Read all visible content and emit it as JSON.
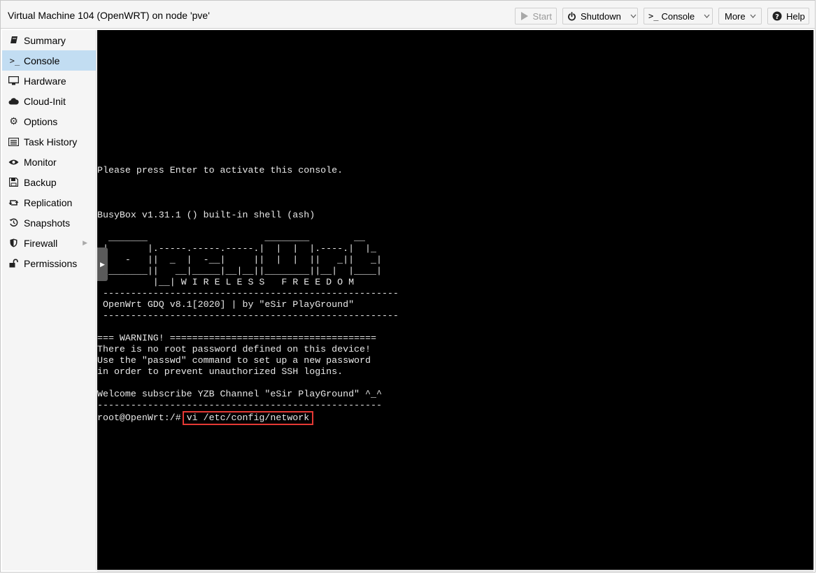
{
  "window": {
    "title": "Virtual Machine 104 (OpenWRT) on node 'pve'"
  },
  "toolbar": {
    "start": {
      "label": "Start",
      "icon": "play-icon"
    },
    "shutdown": {
      "label": "Shutdown",
      "icon": "power-icon"
    },
    "console": {
      "label": "Console",
      "icon": "terminal-icon"
    },
    "more": {
      "label": "More"
    },
    "help": {
      "label": "Help",
      "icon": "question-circle-icon"
    }
  },
  "sidebar": {
    "items": [
      {
        "label": "Summary",
        "icon": "book-icon"
      },
      {
        "label": "Console",
        "icon": "terminal-icon",
        "active": true
      },
      {
        "label": "Hardware",
        "icon": "desktop-icon"
      },
      {
        "label": "Cloud-Init",
        "icon": "cloud-icon"
      },
      {
        "label": "Options",
        "icon": "gear-icon"
      },
      {
        "label": "Task History",
        "icon": "list-icon"
      },
      {
        "label": "Monitor",
        "icon": "eye-icon"
      },
      {
        "label": "Backup",
        "icon": "floppy-icon"
      },
      {
        "label": "Replication",
        "icon": "retweet-icon"
      },
      {
        "label": "Snapshots",
        "icon": "history-icon"
      },
      {
        "label": "Firewall",
        "icon": "shield-icon",
        "has_submenu": true
      },
      {
        "label": "Permissions",
        "icon": "unlock-icon"
      }
    ]
  },
  "console": {
    "lines": {
      "l0": "Please press Enter to activate this console.",
      "l1": "BusyBox v1.31.1 () built-in shell (ash)",
      "logo0": "  _______                     ________        __",
      "logo1": " |       |.-----.-----.-----.|  |  |  |.----.|  |_",
      "logo2": " |   -   ||  _  |  -__|     ||  |  |  ||   _||   _|",
      "logo3": " |_______||   __|_____|__|__||________||__|  |____|",
      "logo4": "          |__| W I R E L E S S   F R E E D O M",
      "sep1": " -----------------------------------------------------",
      "banner": " OpenWrt GDQ v8.1[2020] | by \"eSir PlayGround\"",
      "sep2": " -----------------------------------------------------",
      "w0": "=== WARNING! =====================================",
      "w1": "There is no root password defined on this device!",
      "w2": "Use the \"passwd\" command to set up a new password",
      "w3": "in order to prevent unauthorized SSH logins.",
      "wel": "Welcome subscribe YZB Channel \"eSir PlayGround\" ^_^",
      "sep3": "---------------------------------------------------",
      "prompt": "root@OpenWrt:/#",
      "command": "vi /etc/config/network"
    }
  },
  "colors": {
    "highlight_box": "#e53935",
    "active_nav": "#c2ddf2",
    "terminal_bg": "#000000",
    "terminal_fg": "#e8e8e8"
  }
}
